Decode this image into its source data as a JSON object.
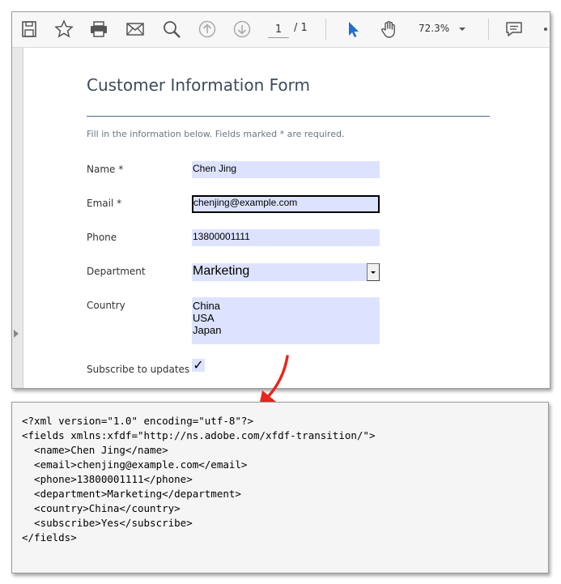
{
  "toolbar": {
    "icons": [
      "save-icon",
      "star-icon",
      "print-icon",
      "email-icon",
      "search-icon",
      "page-up-icon",
      "page-down-icon",
      "select-cursor-icon",
      "hand-tool-icon",
      "comment-icon"
    ],
    "page_current": "1",
    "page_total": "/ 1",
    "zoom": "72.3%"
  },
  "form": {
    "title": "Customer Information Form",
    "instructions": "Fill in the information below. Fields marked * are required.",
    "name_label": "Name *",
    "name_value": "Chen Jing",
    "email_label": "Email *",
    "email_value": "chenjing@example.com",
    "phone_label": "Phone",
    "phone_value": "13800001111",
    "department_label": "Department",
    "department_value": "Marketing",
    "country_label": "Country",
    "country_options": [
      "China",
      "USA",
      "Japan"
    ],
    "subscribe_label": "Subscribe to updates",
    "subscribe_mark": "✓"
  },
  "xml": {
    "lines": [
      "<?xml version=\"1.0\" encoding=\"utf-8\"?>",
      "<fields xmlns:xfdf=\"http://ns.adobe.com/xfdf-transition/\">",
      "  <name>Chen Jing</name>",
      "  <email>chenjing@example.com</email>",
      "  <phone>13800001111</phone>",
      "  <department>Marketing</department>",
      "  <country>China</country>",
      "  <subscribe>Yes</subscribe>",
      "</fields>"
    ]
  },
  "colors": {
    "accent_blue": "#1f6fd0",
    "field_fill": "#dde3ff",
    "arrow_red": "#e8261c"
  }
}
